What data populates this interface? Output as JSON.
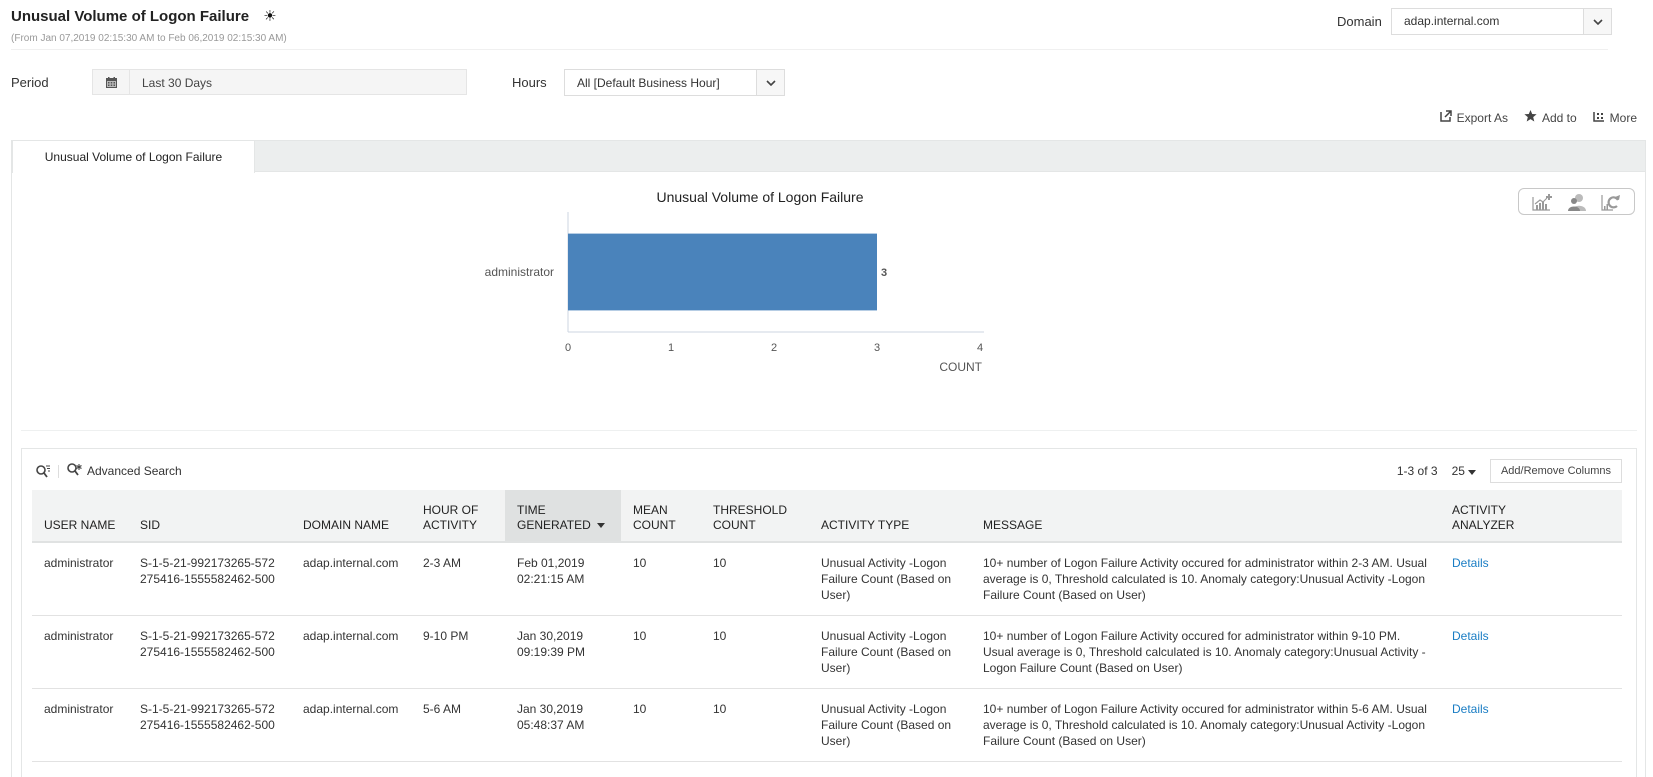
{
  "header": {
    "title": "Unusual Volume of Logon Failure",
    "subtitle": "(From Jan 07,2019 02:15:30 AM to Feb 06,2019 02:15:30 AM)",
    "domain_label": "Domain",
    "domain_value": "adap.internal.com"
  },
  "filters": {
    "period_label": "Period",
    "period_value": "Last 30 Days",
    "hours_label": "Hours",
    "hours_value": "All [Default Business Hour]"
  },
  "actions": {
    "export": "Export As",
    "add_to": "Add to",
    "more": "More"
  },
  "tabs": [
    {
      "label": "Unusual Volume of Logon Failure",
      "active": true
    }
  ],
  "chart_data": {
    "type": "bar",
    "orientation": "horizontal",
    "title": "Unusual Volume of Logon Failure",
    "categories": [
      "administrator"
    ],
    "values": [
      3
    ],
    "data_labels": [
      "3"
    ],
    "xlabel": "COUNT",
    "ylabel": "",
    "xlim": [
      0,
      4
    ],
    "xticks": [
      "0",
      "1",
      "2",
      "3",
      "4"
    ],
    "bar_color": "#4a83bb",
    "grid": false
  },
  "grid": {
    "advanced_search": "Advanced Search",
    "pagination": "1-3 of 3",
    "per_page": "25",
    "add_remove_columns": "Add/Remove Columns",
    "columns": [
      "USER NAME",
      "SID",
      "DOMAIN NAME",
      "HOUR OF\nACTIVITY",
      "TIME\nGENERATED",
      "MEAN\nCOUNT",
      "THRESHOLD\nCOUNT",
      "ACTIVITY TYPE",
      "MESSAGE",
      "ACTIVITY\nANALYZER"
    ],
    "sorted_column": "TIME GENERATED",
    "rows": [
      {
        "user_name": "administrator",
        "sid": "S-1-5-21-992173265-572275416-1555582462-500",
        "domain_name": "adap.internal.com",
        "hour_of_activity": "2-3 AM",
        "time_generated": "Feb 01,2019 02:21:15 AM",
        "mean_count": "10",
        "threshold_count": "10",
        "activity_type": "Unusual Activity -Logon Failure Count (Based on User)",
        "message": "10+ number of Logon Failure Activity occured for administrator within 2-3 AM. Usual average is 0, Threshold calculated is 10. Anomaly category:Unusual Activity -Logon Failure Count (Based on User)",
        "analyzer": "Details"
      },
      {
        "user_name": "administrator",
        "sid": "S-1-5-21-992173265-572275416-1555582462-500",
        "domain_name": "adap.internal.com",
        "hour_of_activity": "9-10 PM",
        "time_generated": "Jan 30,2019 09:19:39 PM",
        "mean_count": "10",
        "threshold_count": "10",
        "activity_type": "Unusual Activity -Logon Failure Count (Based on User)",
        "message": "10+ number of Logon Failure Activity occured for administrator within 9-10 PM. Usual average is 0, Threshold calculated is 10. Anomaly category:Unusual Activity -Logon Failure Count (Based on User)",
        "analyzer": "Details"
      },
      {
        "user_name": "administrator",
        "sid": "S-1-5-21-992173265-572275416-1555582462-500",
        "domain_name": "adap.internal.com",
        "hour_of_activity": "5-6 AM",
        "time_generated": "Jan 30,2019 05:48:37 AM",
        "mean_count": "10",
        "threshold_count": "10",
        "activity_type": "Unusual Activity -Logon Failure Count (Based on User)",
        "message": "10+ number of Logon Failure Activity occured for administrator within 5-6 AM. Usual average is 0, Threshold calculated is 10. Anomaly category:Unusual Activity -Logon Failure Count (Based on User)",
        "analyzer": "Details"
      }
    ]
  }
}
